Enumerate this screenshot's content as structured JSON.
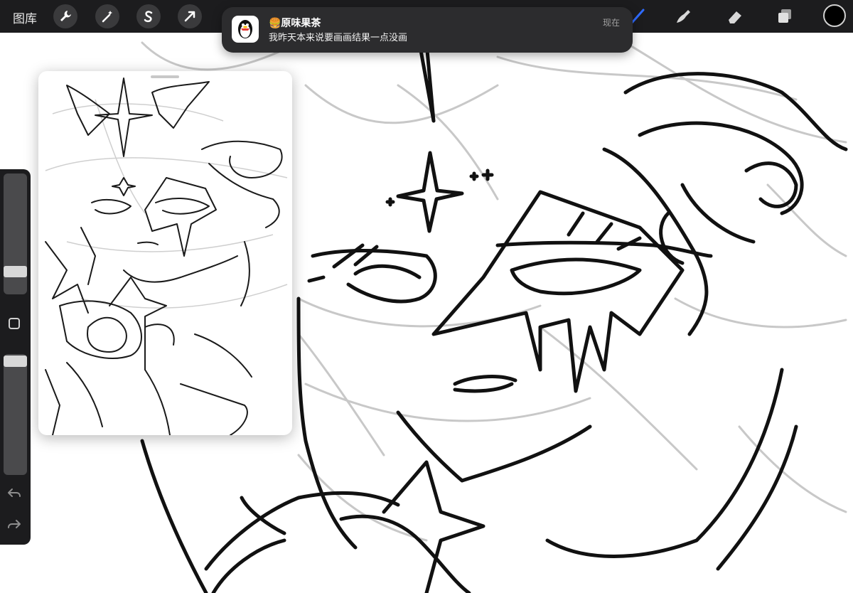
{
  "toolbar": {
    "gallery_label": "图库",
    "actions_icon": "wrench-icon",
    "adjustments_icon": "magic-wand-icon",
    "selection_icon": "selection-s-icon",
    "transform_icon": "arrow-cursor-icon",
    "tools": [
      "brush-icon",
      "smudge-icon",
      "eraser-icon",
      "layers-icon"
    ],
    "current_color": "#000000"
  },
  "notification": {
    "app_icon": "qq-penguin-icon",
    "title": "🍔原味果茶",
    "message": "我昨天本来说要画画结果一点没画",
    "time": "现在"
  },
  "sidebar": {
    "brush_size_level": 0.74,
    "opacity_level": 0.98,
    "modify_button_icon": "square-icon",
    "undo_icon": "undo-icon",
    "redo_icon": "redo-icon"
  },
  "reference_window": {
    "content": "reference-sketch-thumbnail"
  }
}
